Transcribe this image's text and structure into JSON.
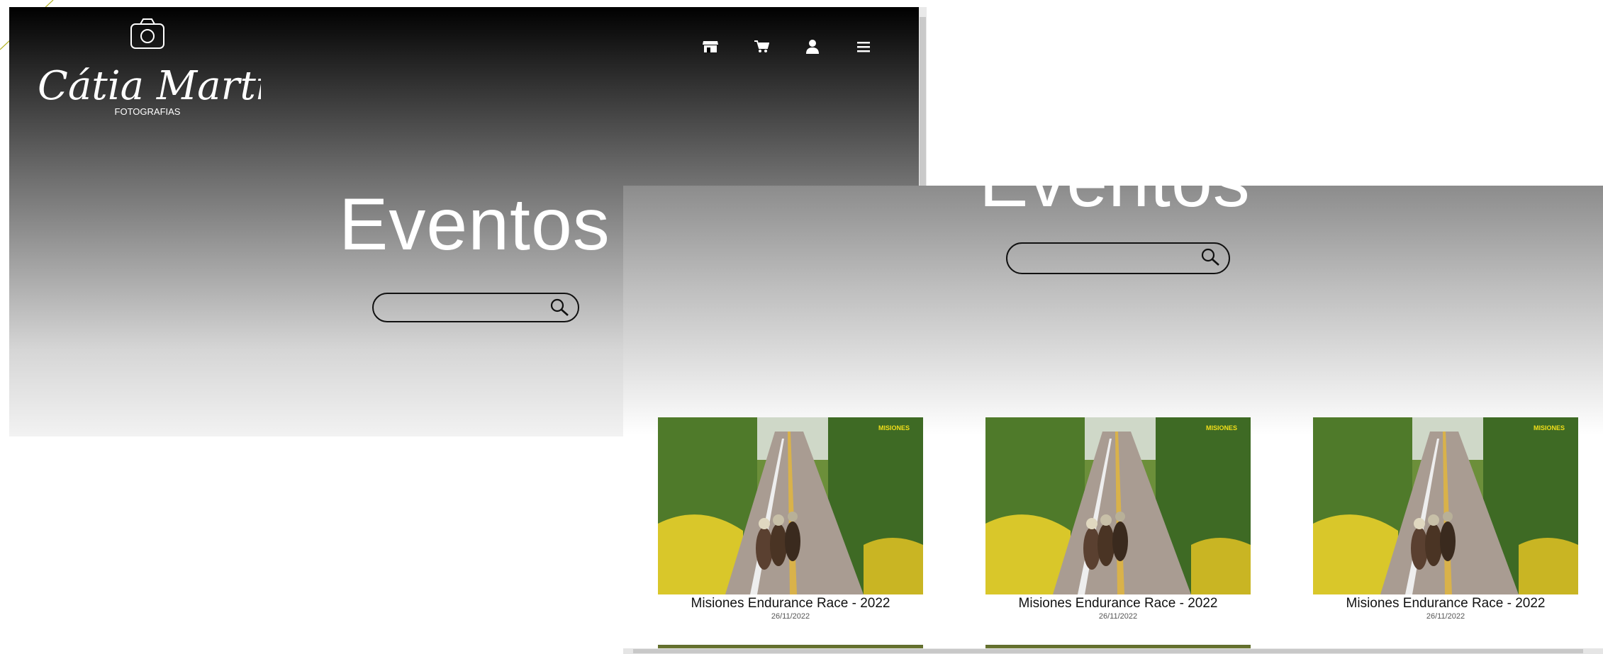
{
  "brand": {
    "logo_script": "Cátia Martins",
    "logo_sub": "FOTOGRAFIAS"
  },
  "nav": {
    "icons": [
      "store-icon",
      "cart-icon",
      "user-icon",
      "menu-icon"
    ]
  },
  "page": {
    "title": "Eventos",
    "search_placeholder": ""
  },
  "events": [
    {
      "title": "Misiones Endurance Race - 2022",
      "date": "26/11/2022",
      "badge": "MISIONES"
    },
    {
      "title": "Misiones Endurance Race - 2022",
      "date": "26/11/2022",
      "badge": "MISIONES"
    },
    {
      "title": "Misiones Endurance Race - 2022",
      "date": "26/11/2022",
      "badge": "MISIONES"
    }
  ],
  "colors": {
    "header_dark": "#000000",
    "accent_line": "#b5b52a"
  }
}
